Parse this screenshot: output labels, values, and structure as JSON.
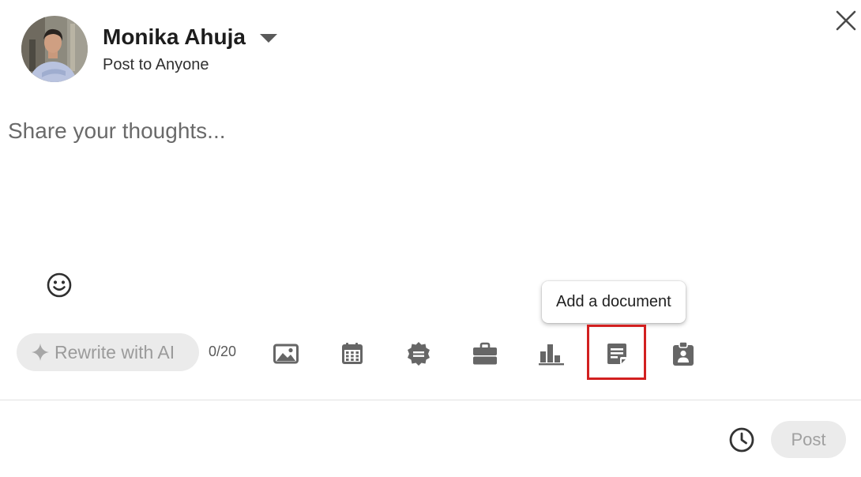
{
  "author": {
    "name": "Monika Ahuja",
    "visibility": "Post to Anyone",
    "avatar_icon": "profile-photo"
  },
  "composer": {
    "placeholder": "Share your thoughts...",
    "value": ""
  },
  "tooltip": {
    "text": "Add a document"
  },
  "toolbar": {
    "rewrite_label": "Rewrite with AI",
    "char_count": "0/20",
    "tools": [
      {
        "icon": "image-icon"
      },
      {
        "icon": "calendar-icon"
      },
      {
        "icon": "celebrate-badge-icon"
      },
      {
        "icon": "briefcase-icon"
      },
      {
        "icon": "poll-chart-icon"
      },
      {
        "icon": "document-icon"
      },
      {
        "icon": "id-badge-icon"
      }
    ]
  },
  "footer": {
    "post_label": "Post",
    "schedule_icon": "clock-icon"
  },
  "colors": {
    "icon": "#666666",
    "highlight": "#d22020",
    "disabled_bg": "#ebebeb",
    "disabled_text": "#a0a0a0"
  }
}
